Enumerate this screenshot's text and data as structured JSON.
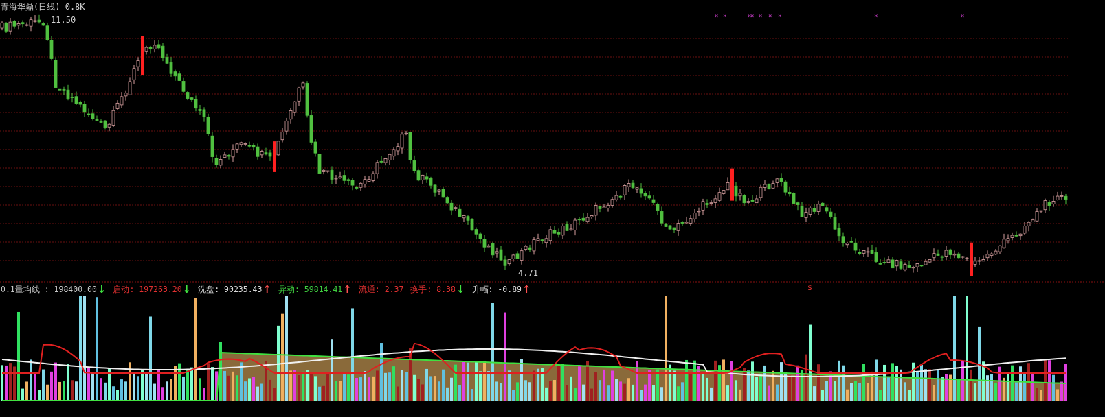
{
  "title": "青海华鼎(日线)",
  "scale": "0.8K",
  "price_chart": {
    "high_label": "11.50",
    "low_label": "4.71",
    "signal_mark": "$"
  },
  "cross_marks": [
    "×",
    "×",
    "×",
    "×",
    "×",
    "×",
    "×",
    "×",
    "×"
  ],
  "indicators": [
    {
      "label": "0.1量均线  :",
      "value": "198400.00",
      "arrow": {
        "glyph": "↓",
        "color": "#40e040"
      },
      "color": "#c8c8c8"
    },
    {
      "label": "启动:",
      "value": "197263.20",
      "arrow": {
        "glyph": "↓",
        "color": "#40e040"
      },
      "color": "#e03030"
    },
    {
      "label": "洗盘:",
      "value": "90235.43",
      "arrow": {
        "glyph": "↑",
        "color": "#ff5050"
      },
      "color": "#d8d8d8"
    },
    {
      "label": "异动:",
      "value": "59814.41",
      "arrow": {
        "glyph": "↑",
        "color": "#ff5050"
      },
      "color": "#40d040"
    },
    {
      "label": "流通:",
      "value": "2.37",
      "color": "#e03030"
    },
    {
      "label": "换手:",
      "value": "8.38",
      "arrow": {
        "glyph": "↓",
        "color": "#40e040"
      },
      "color": "#e03030"
    },
    {
      "label": "升幅:",
      "value": "-0.89",
      "arrow": {
        "glyph": "↑",
        "color": "#ff5050"
      },
      "color": "#d8d8d8"
    }
  ]
}
